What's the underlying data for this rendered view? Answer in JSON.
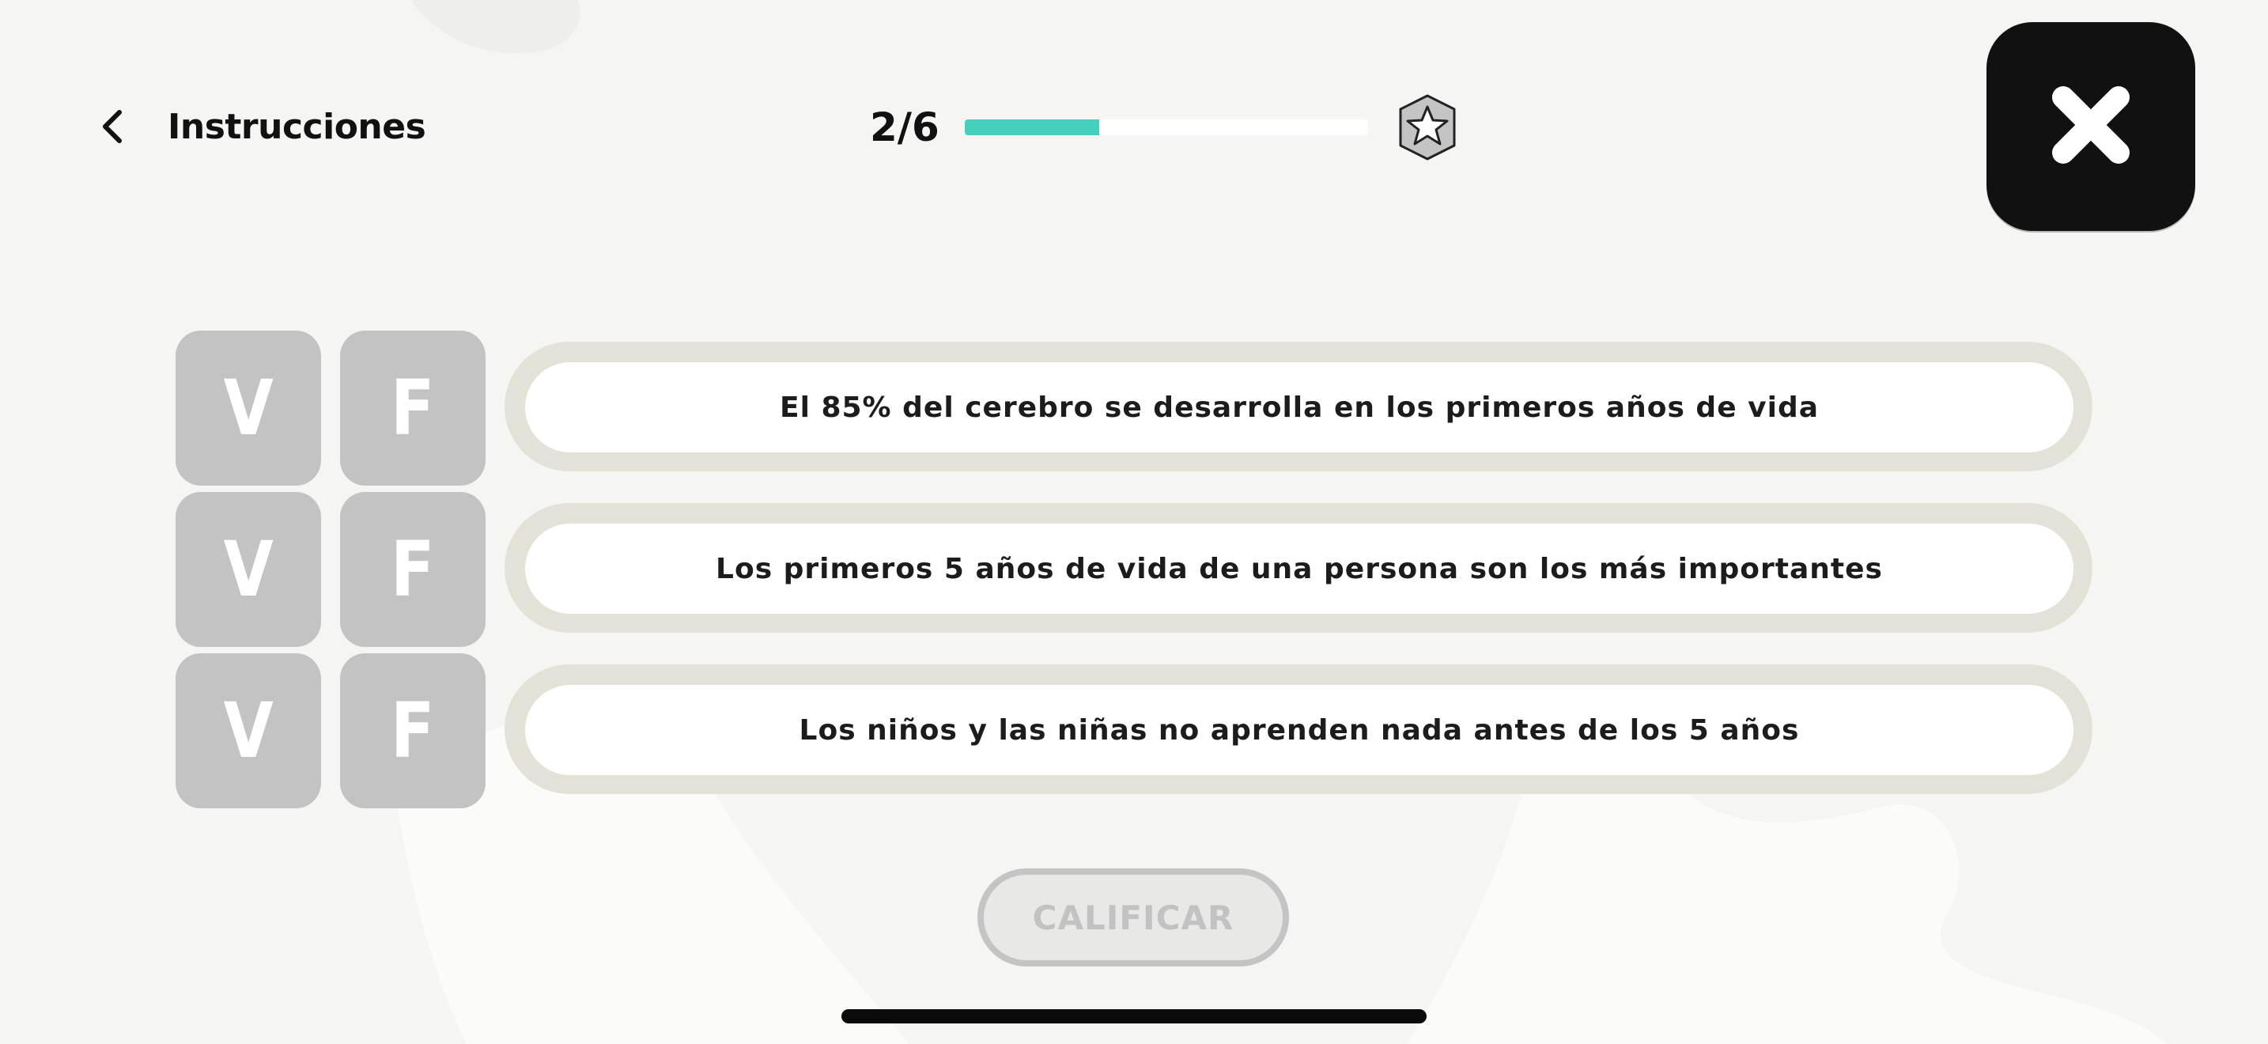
{
  "header": {
    "back_label": "Instrucciones",
    "progress_text": "2/6",
    "progress_fraction": 0.333
  },
  "statements": [
    {
      "true_label": "V",
      "false_label": "F",
      "text": "El 85% del cerebro se desarrolla en los primeros años de vida"
    },
    {
      "true_label": "V",
      "false_label": "F",
      "text": "Los primeros 5 años de vida de una persona son los más importantes"
    },
    {
      "true_label": "V",
      "false_label": "F",
      "text": "Los niños y las niñas no aprenden nada antes de los 5 años"
    }
  ],
  "grade_button": {
    "label": "CALIFICAR",
    "enabled": false
  },
  "icons": {
    "back": "chevron-left-icon",
    "star": "star-badge-icon",
    "close": "close-icon"
  },
  "colors": {
    "background": "#f5f5f3",
    "progress_fill": "#45cfbd",
    "answer_button": "#c3c3c3",
    "statement_border": "#e4e2d7",
    "close_button": "#111111"
  }
}
